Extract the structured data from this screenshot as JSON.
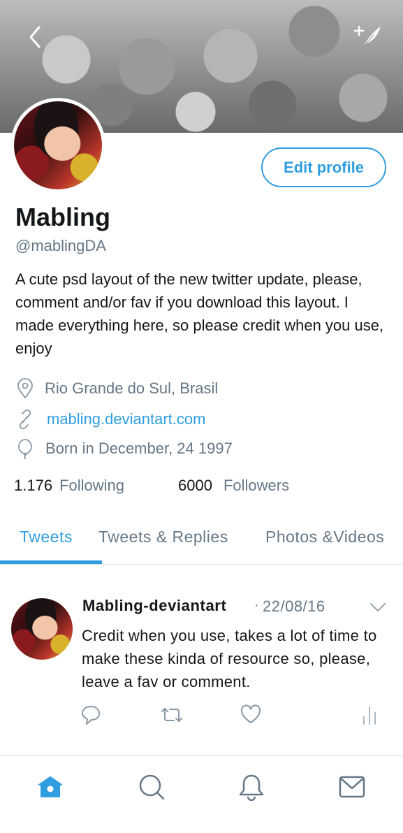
{
  "header": {
    "back_icon": "chevron-left-icon",
    "compose_icon": "compose-feather-icon"
  },
  "profile": {
    "edit_label": "Edit profile",
    "name": "Mabling",
    "handle": "@mablingDA",
    "bio": "A cute psd layout of the new twitter update, please, comment and/or fav if you download this layout. I made everything here, so please credit when you use, enjoy",
    "location": "Rio Grande do Sul, Brasil",
    "website": "mabling.deviantart.com",
    "birthday": "Born in December, 24 1997",
    "following_count": "1.176",
    "following_label": "Following",
    "followers_count": "6000",
    "followers_label": "Followers"
  },
  "tabs": [
    {
      "label": "Tweets",
      "active": true
    },
    {
      "label": "Tweets & Replies",
      "active": false
    },
    {
      "label": "Photos &Videos",
      "active": false
    }
  ],
  "tweet": {
    "author": "Mabling-deviantart",
    "separator": "·",
    "date": "22/08/16",
    "text": "Credit when you use, takes a lot of time to make these kinda of resource so, please, leave a fav or comment."
  },
  "bottom_nav": [
    "home-icon",
    "search-icon",
    "notifications-bell-icon",
    "messages-envelope-icon"
  ],
  "colors": {
    "accent": "#2f9ee0",
    "secondary_text": "#657786",
    "primary_text": "#14171a"
  }
}
